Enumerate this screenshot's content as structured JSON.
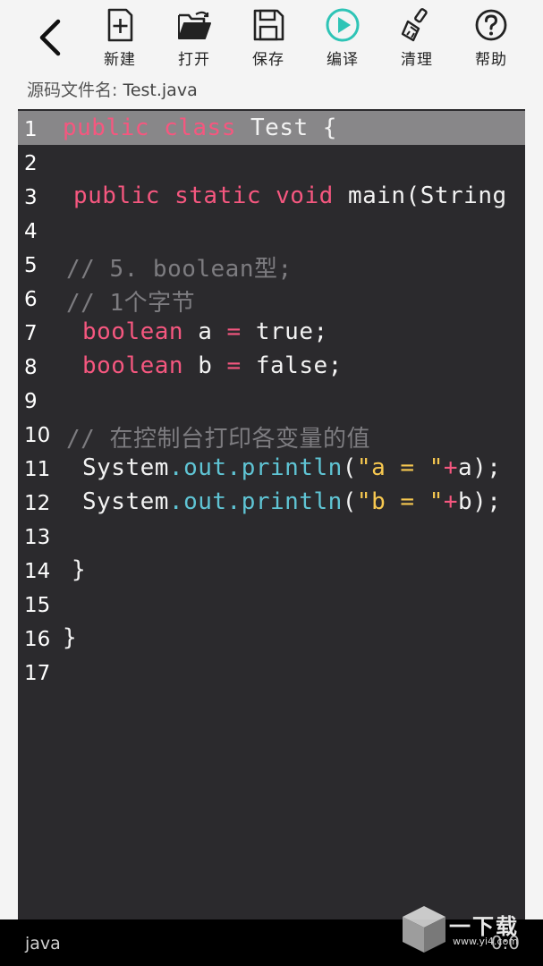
{
  "toolbar": {
    "items": [
      {
        "label": "新建",
        "icon": "new-file-icon"
      },
      {
        "label": "打开",
        "icon": "open-folder-icon"
      },
      {
        "label": "保存",
        "icon": "save-icon"
      },
      {
        "label": "编译",
        "icon": "compile-play-icon"
      },
      {
        "label": "清理",
        "icon": "broom-icon"
      },
      {
        "label": "帮助",
        "icon": "help-icon"
      }
    ]
  },
  "file": {
    "prefix": "源码文件名:",
    "name": "Test.java"
  },
  "editor": {
    "highlighted_line": 1,
    "lines": [
      {
        "n": "1"
      },
      {
        "n": "2"
      },
      {
        "n": "3"
      },
      {
        "n": "4"
      },
      {
        "n": "5"
      },
      {
        "n": "6"
      },
      {
        "n": "7"
      },
      {
        "n": "8"
      },
      {
        "n": "9"
      },
      {
        "n": "10"
      },
      {
        "n": "11"
      },
      {
        "n": "12"
      },
      {
        "n": "13"
      },
      {
        "n": "14"
      },
      {
        "n": "15"
      },
      {
        "n": "16"
      },
      {
        "n": "17"
      }
    ],
    "code": {
      "l1": [
        "public",
        "class",
        "Test {"
      ],
      "l3": [
        "public",
        "static",
        "void",
        "main(String"
      ],
      "l5": "// 5. boolean型;",
      "l6": "// 1个字节",
      "l7": [
        "boolean",
        " a ",
        "=",
        " true;"
      ],
      "l8": [
        "boolean",
        " b ",
        "=",
        " false;"
      ],
      "l10": "// 在控制台打印各变量的值",
      "l11": [
        "System",
        ".out.println",
        "(",
        "\"a = \"",
        "+",
        "a);"
      ],
      "l12": [
        "System",
        ".out.println",
        "(",
        "\"b = \"",
        "+",
        "b);"
      ],
      "l14": "}",
      "l16": "}"
    }
  },
  "status": {
    "language": "java",
    "position": "0:0"
  },
  "watermark": {
    "text": "一下载",
    "url": "www.yi4.com"
  },
  "colors": {
    "keyword": "#f5577f",
    "comment": "#7d7c80",
    "method": "#5fc4d4",
    "string": "#f7c850",
    "editor_bg": "#2b2a2d",
    "highlight": "#888789"
  }
}
